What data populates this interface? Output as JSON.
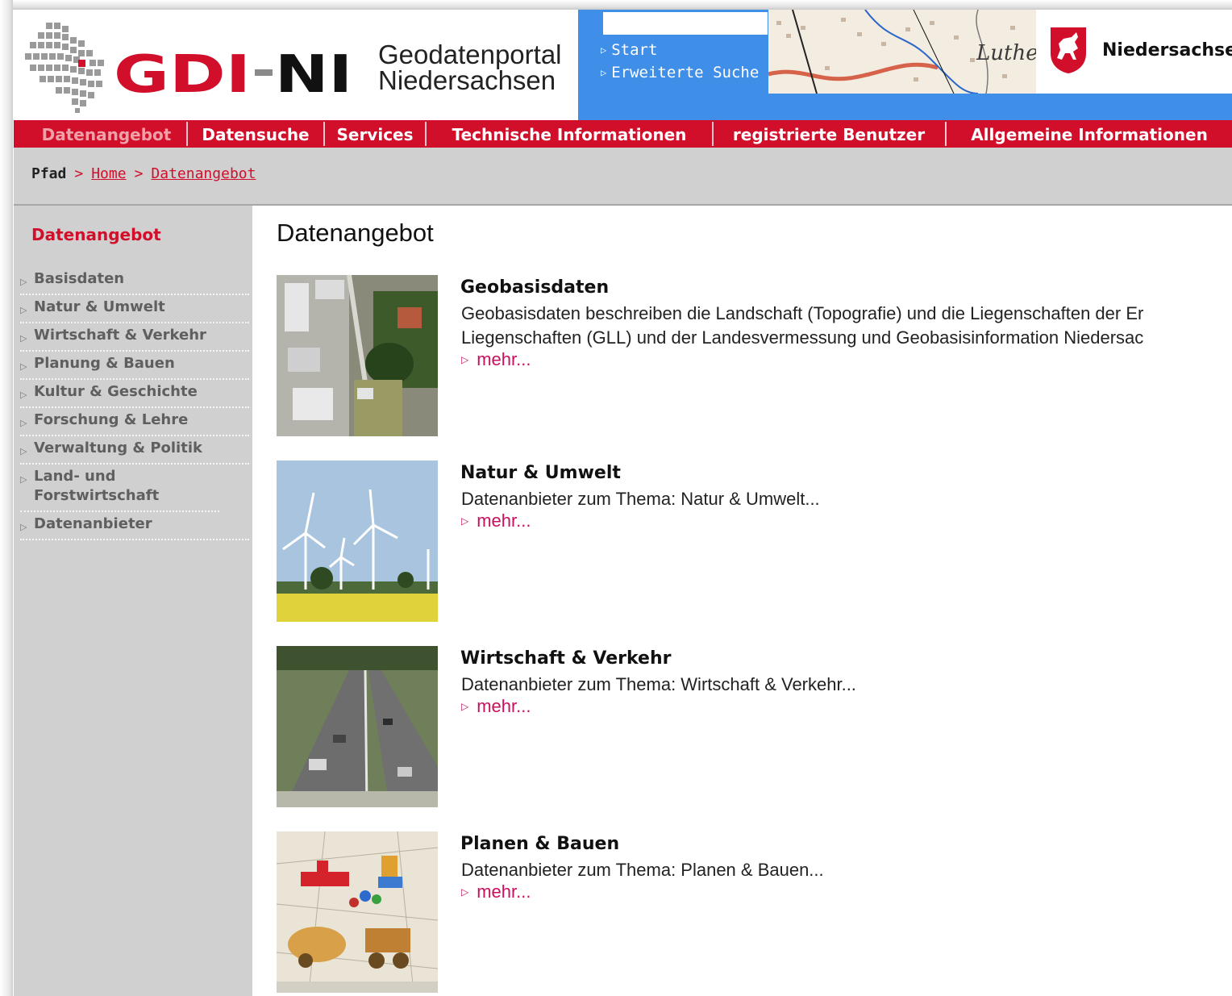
{
  "header": {
    "brand": "GDI-NI",
    "portal_title_line1": "Geodatenportal",
    "portal_title_line2": "Niedersachsen",
    "search_value": "",
    "quick_links": [
      "Start",
      "Erweiterte Suche"
    ],
    "map_label": "Luthe",
    "state_label": "Niedersachsen"
  },
  "nav": {
    "tabs": [
      {
        "label": "Datenangebot",
        "active": true
      },
      {
        "label": "Datensuche"
      },
      {
        "label": "Services"
      },
      {
        "label": "Technische Informationen"
      },
      {
        "label": "registrierte Benutzer"
      },
      {
        "label": "Allgemeine Informationen"
      }
    ]
  },
  "breadcrumb": {
    "label": "Pfad",
    "separator": ">",
    "items": [
      "Home",
      "Datenangebot"
    ]
  },
  "sidebar": {
    "title": "Datenangebot",
    "items": [
      "Basisdaten",
      "Natur & Umwelt",
      "Wirtschaft & Verkehr",
      "Planung & Bauen",
      "Kultur & Geschichte",
      "Forschung & Lehre",
      "Verwaltung & Politik",
      "Land- und Forstwirtschaft",
      "Datenanbieter"
    ]
  },
  "content": {
    "title": "Datenangebot",
    "entries": [
      {
        "title": "Geobasisdaten",
        "text": [
          "Geobasisdaten beschreiben die Landschaft (Topografie) und die Liegenschaften der Er",
          "Liegenschaften (GLL) und der Landesvermessung und Geobasisinformation Niedersac"
        ],
        "more": "mehr..."
      },
      {
        "title": "Natur & Umwelt",
        "text": [
          "Datenanbieter zum Thema: Natur & Umwelt..."
        ],
        "more": "mehr..."
      },
      {
        "title": "Wirtschaft & Verkehr",
        "text": [
          "Datenanbieter zum Thema: Wirtschaft & Verkehr..."
        ],
        "more": "mehr..."
      },
      {
        "title": "Planen & Bauen",
        "text": [
          "Datenanbieter zum Thema: Planen & Bauen..."
        ],
        "more": "mehr..."
      }
    ]
  },
  "colors": {
    "brand_red": "#d10f2a",
    "header_blue": "#3f8ee8",
    "sidebar_gray": "#d0d0d0",
    "link_magenta": "#c8105e"
  }
}
